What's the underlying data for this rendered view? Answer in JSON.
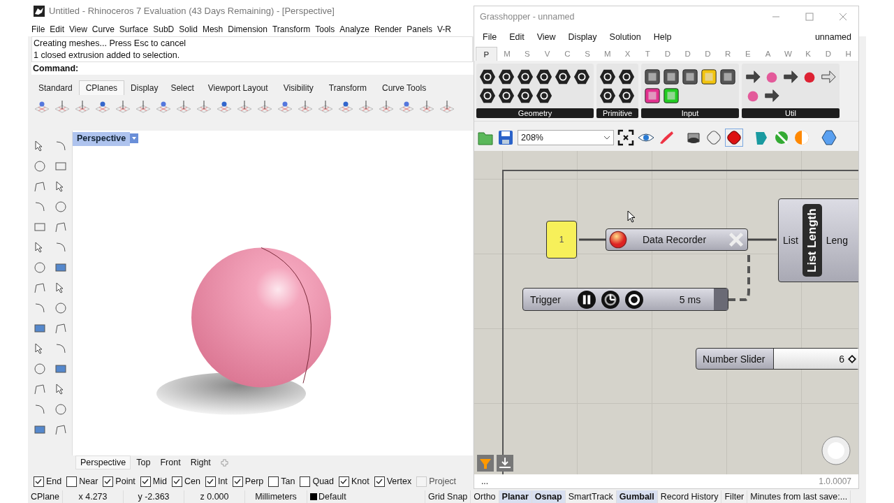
{
  "rhino": {
    "title": "Untitled - Rhinoceros 7 Evaluation (43 Days Remaining) - [Perspective]",
    "menu": [
      "File",
      "Edit",
      "View",
      "Curve",
      "Surface",
      "SubD",
      "Solid",
      "Mesh",
      "Dimension",
      "Transform",
      "Tools",
      "Analyze",
      "Render",
      "Panels",
      "V-R"
    ],
    "command_history": [
      "Creating meshes... Press Esc to cancel",
      "1 closed extrusion added to selection."
    ],
    "command_label": "Command:",
    "toolbar_tabs": [
      {
        "label": "Standard",
        "selected": false
      },
      {
        "label": "CPlanes",
        "selected": true
      },
      {
        "label": "Display",
        "selected": false
      },
      {
        "label": "Select",
        "selected": false
      },
      {
        "label": "Viewport Layout",
        "selected": false
      },
      {
        "label": "Visibility",
        "selected": false
      },
      {
        "label": "Transform",
        "selected": false
      },
      {
        "label": "Curve Tools",
        "selected": false
      }
    ],
    "viewport_label": "Perspective",
    "viewport_tabs": [
      {
        "label": "Perspective",
        "selected": true
      },
      {
        "label": "Top",
        "selected": false
      },
      {
        "label": "Front",
        "selected": false
      },
      {
        "label": "Right",
        "selected": false
      }
    ],
    "osnaps": [
      {
        "label": "End",
        "checked": true,
        "disabled": false
      },
      {
        "label": "Near",
        "checked": false,
        "disabled": false
      },
      {
        "label": "Point",
        "checked": true,
        "disabled": false
      },
      {
        "label": "Mid",
        "checked": true,
        "disabled": false
      },
      {
        "label": "Cen",
        "checked": true,
        "disabled": false
      },
      {
        "label": "Int",
        "checked": true,
        "disabled": false
      },
      {
        "label": "Perp",
        "checked": true,
        "disabled": false
      },
      {
        "label": "Tan",
        "checked": false,
        "disabled": false
      },
      {
        "label": "Quad",
        "checked": false,
        "disabled": false
      },
      {
        "label": "Knot",
        "checked": true,
        "disabled": false
      },
      {
        "label": "Vertex",
        "checked": true,
        "disabled": false
      },
      {
        "label": "Project",
        "checked": false,
        "disabled": true
      }
    ],
    "status_bar": [
      {
        "kind": "field",
        "label": "CPlane"
      },
      {
        "kind": "field",
        "label": "x 4.273"
      },
      {
        "kind": "field",
        "label": "y -2.363"
      },
      {
        "kind": "field",
        "label": "z 0.000"
      },
      {
        "kind": "field",
        "label": "Millimeters"
      },
      {
        "kind": "layer",
        "label": "Default",
        "color": "#000000"
      },
      {
        "kind": "toggle",
        "label": "Grid Snap",
        "on": false
      },
      {
        "kind": "toggle",
        "label": "Ortho",
        "on": false
      },
      {
        "kind": "toggle",
        "label": "Planar",
        "on": true
      },
      {
        "kind": "toggle",
        "label": "Osnap",
        "on": true
      },
      {
        "kind": "toggle",
        "label": "SmartTrack",
        "on": false
      },
      {
        "kind": "toggle",
        "label": "Gumball",
        "on": true
      },
      {
        "kind": "toggle",
        "label": "Record History",
        "on": false
      },
      {
        "kind": "toggle",
        "label": "Filter",
        "on": false
      },
      {
        "kind": "field",
        "label": "Minutes from last save:..."
      }
    ]
  },
  "grasshopper": {
    "title": "Grasshopper - unnamed",
    "menu": [
      "File",
      "Edit",
      "View",
      "Display",
      "Solution",
      "Help"
    ],
    "document_name": "unnamed",
    "tabs": [
      {
        "label": "P",
        "selected": true
      },
      {
        "label": "M",
        "selected": false
      },
      {
        "label": "S",
        "selected": false
      },
      {
        "label": "V",
        "selected": false
      },
      {
        "label": "C",
        "selected": false
      },
      {
        "label": "S",
        "selected": false
      },
      {
        "label": "M",
        "selected": false
      },
      {
        "label": "X",
        "selected": false
      },
      {
        "label": "T",
        "selected": false
      },
      {
        "label": "D",
        "selected": false
      },
      {
        "label": "D",
        "selected": false
      },
      {
        "label": "D",
        "selected": false
      },
      {
        "label": "R",
        "selected": false
      },
      {
        "label": "E",
        "selected": false
      },
      {
        "label": "A",
        "selected": false
      },
      {
        "label": "W",
        "selected": false
      },
      {
        "label": "K",
        "selected": false
      },
      {
        "label": "D",
        "selected": false
      },
      {
        "label": "H",
        "selected": false
      }
    ],
    "ribbon_groups": [
      {
        "label": "Geometry",
        "kind": "hex"
      },
      {
        "label": "Primitive",
        "kind": "hex"
      },
      {
        "label": "Input",
        "kind": "square"
      },
      {
        "label": "Util",
        "kind": "util"
      }
    ],
    "zoom": "208%",
    "canvas": {
      "panel": {
        "value": "1"
      },
      "data_recorder": {
        "title": "Data Recorder"
      },
      "list_length": {
        "input": "List",
        "title": "List Length",
        "output": "Leng"
      },
      "trigger": {
        "title": "Trigger",
        "interval": "5 ms"
      },
      "number_slider": {
        "title": "Number Slider",
        "value": "6"
      }
    },
    "status_left": "...",
    "version": "1.0.0007"
  }
}
